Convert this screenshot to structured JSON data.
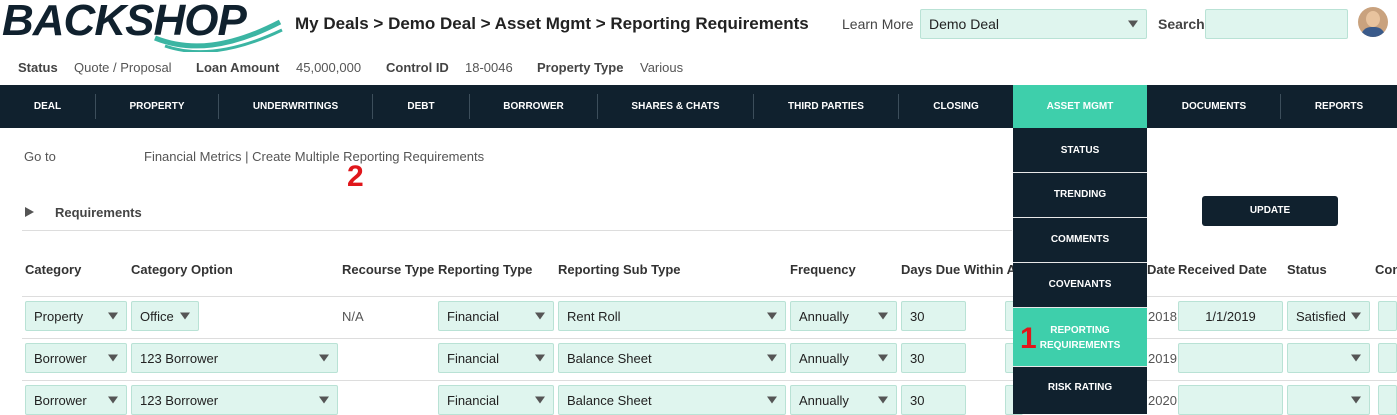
{
  "header": {
    "logo_text": "BACKSHOP",
    "breadcrumb": "My Deals > Demo Deal > Asset Mgmt > Reporting Requirements",
    "learn_more": "Learn More",
    "deal_select_value": "Demo Deal",
    "search_label": "Search",
    "search_value": ""
  },
  "info": {
    "status_label": "Status",
    "status_value": "Quote / Proposal",
    "loan_label": "Loan Amount",
    "loan_value": "45,000,000",
    "control_label": "Control ID",
    "control_value": "18-0046",
    "property_label": "Property Type",
    "property_value": "Various"
  },
  "nav": {
    "items": [
      "DEAL",
      "PROPERTY",
      "UNDERWRITINGS",
      "DEBT",
      "BORROWER",
      "SHARES & CHATS",
      "THIRD PARTIES",
      "CLOSING",
      "ASSET MGMT",
      "DOCUMENTS",
      "REPORTS"
    ],
    "active": "ASSET MGMT"
  },
  "dropdown": {
    "items": [
      "STATUS",
      "TRENDING",
      "COMMENTS",
      "COVENANTS",
      "REPORTING REQUIREMENTS",
      "RISK RATING"
    ],
    "active": "REPORTING REQUIREMENTS"
  },
  "goto": {
    "label": "Go to",
    "links": "Financial Metrics | Create Multiple Reporting Requirements"
  },
  "annotations": {
    "one": "1",
    "two": "2"
  },
  "requirements": {
    "title": "Requirements",
    "update_label": "UPDATE"
  },
  "table": {
    "headers": [
      "Category",
      "Category Option",
      "Recourse Type",
      "Reporting Type",
      "Reporting Sub Type",
      "Frequency",
      "Days Due Within A",
      "Date",
      "Received Date",
      "Status",
      "Con"
    ],
    "rows": [
      {
        "category": "Property",
        "category_option": "Office",
        "recourse": "N/A",
        "reporting_type": "Financial",
        "sub_type": "Rent Roll",
        "frequency": "Annually",
        "days_due": "30",
        "date_fragment": "2018",
        "received_date": "1/1/2019",
        "status": "Satisfied"
      },
      {
        "category": "Borrower",
        "category_option": "123 Borrower",
        "recourse": "",
        "reporting_type": "Financial",
        "sub_type": "Balance Sheet",
        "frequency": "Annually",
        "days_due": "30",
        "date_fragment": "2019",
        "received_date": "",
        "status": ""
      },
      {
        "category": "Borrower",
        "category_option": "123 Borrower",
        "recourse": "",
        "reporting_type": "Financial",
        "sub_type": "Balance Sheet",
        "frequency": "Annually",
        "days_due": "30",
        "date_fragment": "2020",
        "received_date": "",
        "status": ""
      }
    ]
  }
}
